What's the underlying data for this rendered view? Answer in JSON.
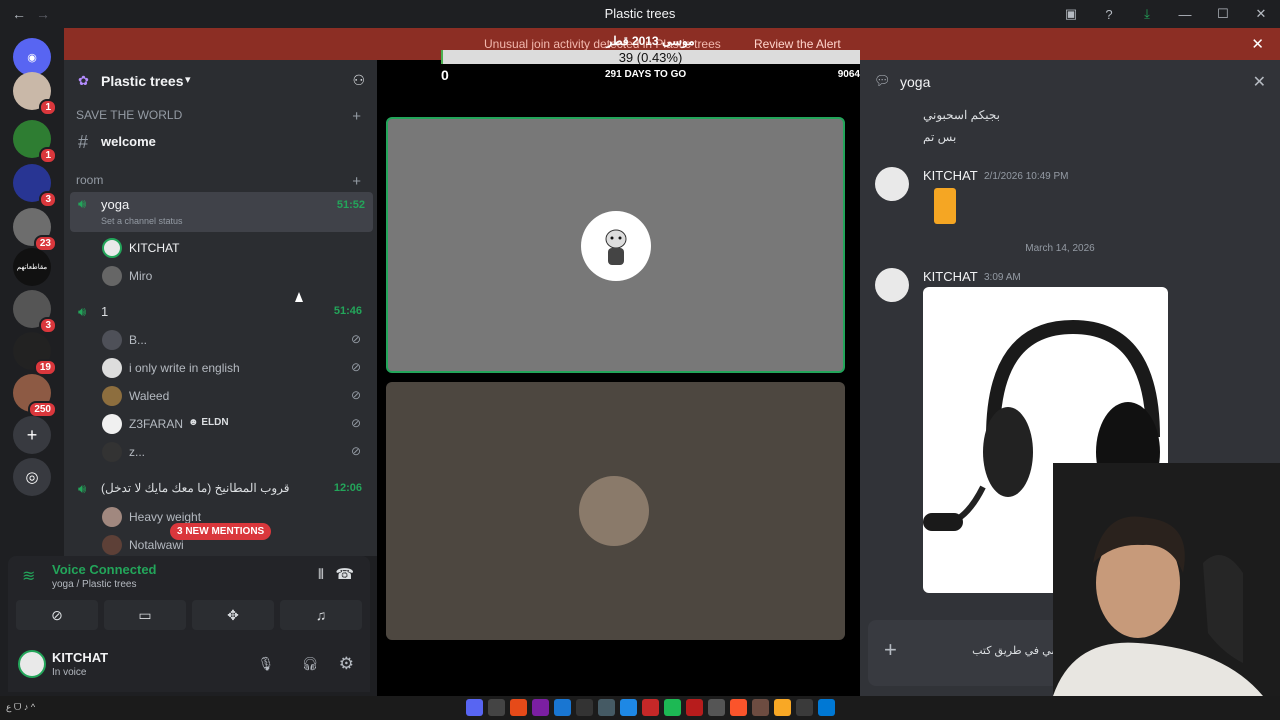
{
  "window": {
    "title": "Plastic trees",
    "back": "←",
    "forward": "→"
  },
  "alert": {
    "message": "Unusual join activity detected in Plastic trees",
    "action": "Review the Alert",
    "close": "✕"
  },
  "guilds": [
    {
      "badge": "1"
    },
    {
      "badge": "1"
    },
    {
      "badge": "3"
    },
    {
      "badge": "23"
    },
    {
      "label": "مقاطعاتهم",
      "badge": ""
    },
    {
      "badge": "3"
    },
    {
      "badge": "19"
    },
    {
      "badge": "250"
    }
  ],
  "server": {
    "name": "Plastic trees",
    "category1": "SAVE THE WORLD",
    "text_channel": "welcome",
    "category2": "room",
    "voice_channels": [
      {
        "name": "yoga",
        "timer": "51:52",
        "status": "Set a channel status",
        "users": [
          "KITCHAT",
          "Miro"
        ]
      },
      {
        "name": "1",
        "timer": "51:46",
        "users": [
          "B...",
          "i only write in english",
          "Waleed",
          "Z3FARAN",
          "z..."
        ]
      },
      {
        "name": "قروب المطانيخ (ما معك مايك لا تدخل)",
        "timer": "12:06",
        "users": [
          "Heavy weight",
          "Notalwawi"
        ]
      }
    ],
    "eldn_tag": "ELDN",
    "new_mentions": "3 NEW MENTIONS"
  },
  "voice_panel": {
    "status": "Voice Connected",
    "location": "yoga / Plastic trees"
  },
  "user_panel": {
    "name": "KITCHAT",
    "status": "In voice"
  },
  "stage": {
    "progress_label": "39 (0.43%)",
    "progress_value": 0.0043,
    "progress_header": "موسى 2013 قطر",
    "start": "0",
    "days_to_go": "291 DAYS TO GO",
    "goal": "9064"
  },
  "chat": {
    "channel": "yoga",
    "close": "✕",
    "earlier_lines": [
      "بجيكم اسحبوني",
      "بس تم"
    ],
    "messages": [
      {
        "author": "KITCHAT",
        "time": "2/1/2026 10:49 PM"
      },
      {
        "author": "KITCHAT",
        "time": "3:09 AM"
      }
    ],
    "date_divider": "March 14, 2026",
    "composer_text": "ام هو يمشي في طريق كتب"
  },
  "taskbar": {
    "tray_text": "ع  ᗜ  ♪  ^"
  },
  "colors": {
    "green": "#23a55a",
    "alert": "#8c2e24",
    "mention": "#da373c"
  }
}
